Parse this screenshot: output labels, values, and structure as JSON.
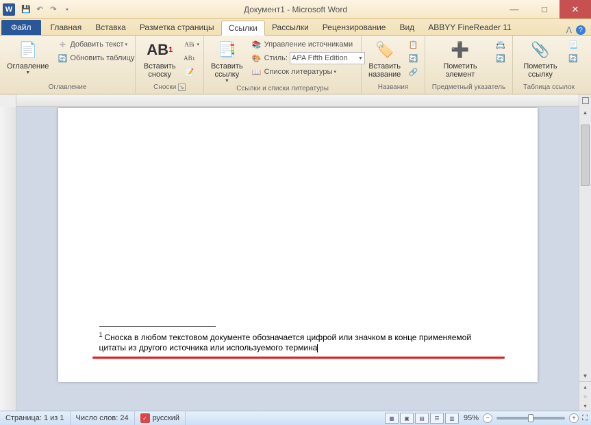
{
  "titlebar": {
    "app_icon_letter": "W",
    "title": "Документ1 - Microsoft Word"
  },
  "tabs": {
    "file": "Файл",
    "items": [
      "Главная",
      "Вставка",
      "Разметка страницы",
      "Ссылки",
      "Рассылки",
      "Рецензирование",
      "Вид",
      "ABBYY FineReader 11"
    ],
    "active_index": 3
  },
  "ribbon": {
    "toc": {
      "big": "Оглавление",
      "add_text": "Добавить текст",
      "update": "Обновить таблицу",
      "group": "Оглавление"
    },
    "footnotes": {
      "big": "Вставить сноску",
      "ab_label": "AB",
      "group": "Сноски"
    },
    "citations": {
      "big": "Вставить ссылку",
      "manage": "Управление источниками",
      "style_label": "Стиль:",
      "style_value": "APA Fifth Edition",
      "biblio": "Список литературы",
      "group": "Ссылки и списки литературы"
    },
    "captions": {
      "big": "Вставить название",
      "group": "Названия"
    },
    "index": {
      "big": "Пометить элемент",
      "group": "Предметный указатель"
    },
    "toa": {
      "big": "Пометить ссылку",
      "group": "Таблица ссылок"
    }
  },
  "document": {
    "footnote_marker": "1",
    "footnote_text": "Сноска в любом текстовом документе обозначается цифрой или значком в конце применяемой цитаты из другого источника или используемого термина"
  },
  "statusbar": {
    "page": "Страница: 1 из 1",
    "words": "Число слов: 24",
    "language": "русский",
    "zoom": "95%"
  }
}
